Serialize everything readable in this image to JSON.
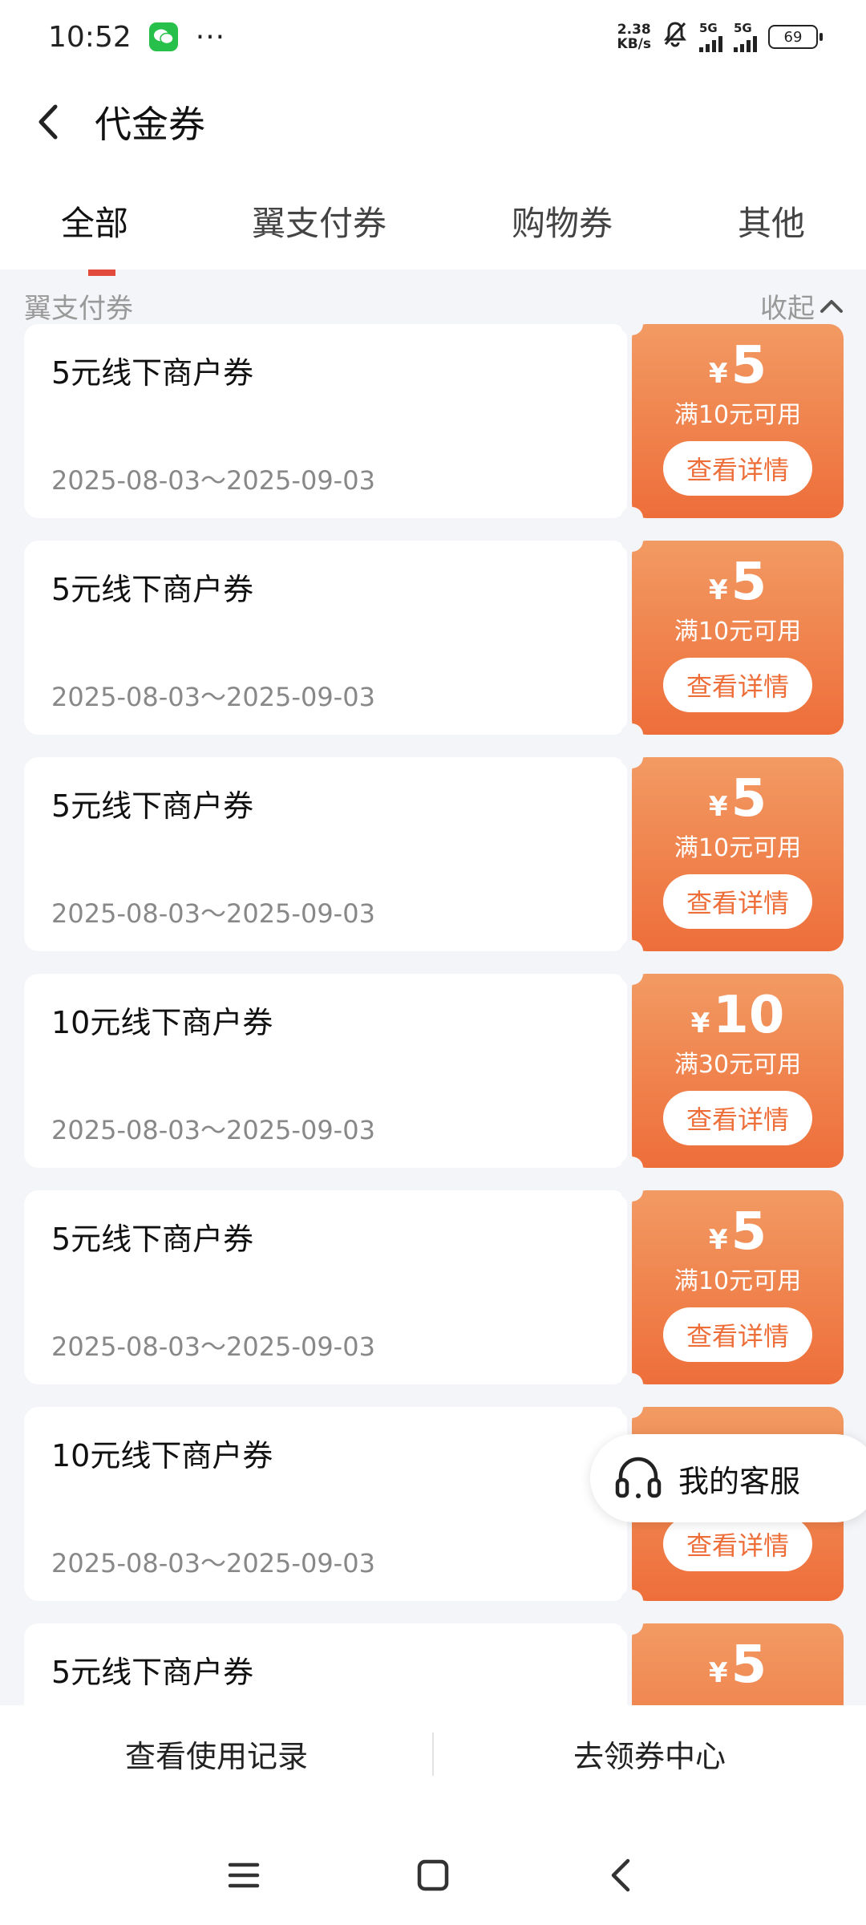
{
  "status": {
    "time": "10:52",
    "dots": "···",
    "speed_top": "2.38",
    "speed_unit": "KB/s",
    "net1": "5G",
    "net2": "5G",
    "battery": "69"
  },
  "header": {
    "title": "代金券"
  },
  "tabs": [
    "全部",
    "翼支付券",
    "购物券",
    "其他"
  ],
  "section": {
    "title": "翼支付券",
    "collapse_label": "收起"
  },
  "coupons": [
    {
      "name": "5元线下商户券",
      "date": "2025-08-03～2025-09-03",
      "currency": "¥",
      "amount": "5",
      "condition": "满10元可用",
      "button": "查看详情"
    },
    {
      "name": "5元线下商户券",
      "date": "2025-08-03～2025-09-03",
      "currency": "¥",
      "amount": "5",
      "condition": "满10元可用",
      "button": "查看详情"
    },
    {
      "name": "5元线下商户券",
      "date": "2025-08-03～2025-09-03",
      "currency": "¥",
      "amount": "5",
      "condition": "满10元可用",
      "button": "查看详情"
    },
    {
      "name": "10元线下商户券",
      "date": "2025-08-03～2025-09-03",
      "currency": "¥",
      "amount": "10",
      "condition": "满30元可用",
      "button": "查看详情"
    },
    {
      "name": "5元线下商户券",
      "date": "2025-08-03～2025-09-03",
      "currency": "¥",
      "amount": "5",
      "condition": "满10元可用",
      "button": "查看详情"
    },
    {
      "name": "10元线下商户券",
      "date": "2025-08-03～2025-09-03",
      "currency": "¥",
      "amount": "",
      "condition": "",
      "button": "查看详情"
    },
    {
      "name": "5元线下商户券",
      "date": "",
      "currency": "¥",
      "amount": "5",
      "condition": "",
      "button": ""
    }
  ],
  "service": {
    "label": "我的客服",
    "icon": "headset-icon"
  },
  "bottom": {
    "records": "查看使用记录",
    "center": "去领券中心"
  },
  "nav": {
    "menu_icon": "menu-icon",
    "home_icon": "home-icon",
    "back_icon": "back-icon"
  },
  "colors": {
    "accent": "#ee6e3a",
    "accent_light": "#f29a63",
    "background": "#f4f5f8"
  }
}
